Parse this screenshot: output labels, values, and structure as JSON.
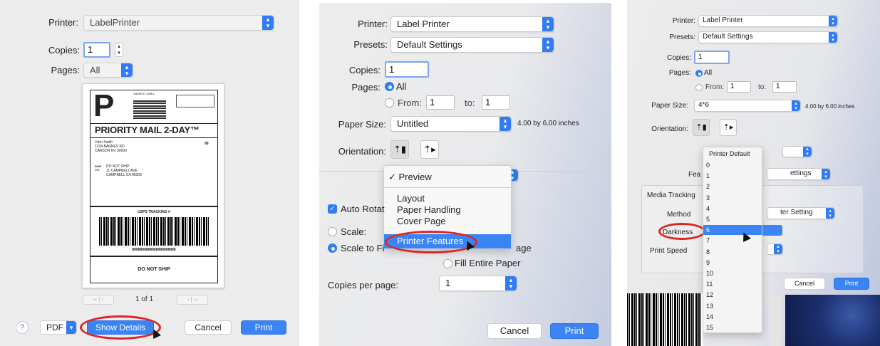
{
  "panel1": {
    "printer_label": "Printer:",
    "printer_value": "LabelPrinter",
    "copies_label": "Copies:",
    "copies_value": "1",
    "pages_label": "Pages:",
    "pages_value": "All",
    "preview": {
      "big_letter": "P",
      "small_header": "SAMPLE LABEL",
      "service": "PRIORITY MAIL 2-DAY™",
      "sender": [
        "John Smith",
        "1234 BARNES RD",
        "CARSON NV 30000"
      ],
      "zone": "99",
      "ship_label": "SHIP\nTO:",
      "ship_to": [
        "DO NOT SHIP",
        "11 CAMPBELL AVE",
        "CAMPBELL CA 95009"
      ],
      "tracking_label": "USPS TRACKING #",
      "tracking_number": "8888888888888888888888",
      "footer": "DO NOT SHIP"
    },
    "page_counter": "1 of 1",
    "help_label": "?",
    "pdf_label": "PDF",
    "show_details_label": "Show Details",
    "cancel_label": "Cancel",
    "print_label": "Print"
  },
  "panel2": {
    "printer_label": "Printer:",
    "printer_value": "Label Printer",
    "presets_label": "Presets:",
    "presets_value": "Default Settings",
    "copies_label": "Copies:",
    "copies_value": "1",
    "pages_label": "Pages:",
    "all_label": "All",
    "from_label": "From:",
    "from_value": "1",
    "to_label": "to:",
    "to_value": "1",
    "paper_size_label": "Paper Size:",
    "paper_size_value": "Untitled",
    "paper_size_desc": "4.00 by 6.00 inches",
    "orientation_label": "Orientation:",
    "menu": {
      "checked_item": "✓ Preview",
      "items": [
        "Layout",
        "Paper Handling",
        "Cover Page"
      ],
      "highlighted_item": "Printer Features"
    },
    "auto_rotate_label": "Auto Rotat",
    "scale_label": "Scale:",
    "scale_to_fit_label": "Scale to Fi",
    "age_fragment": "age",
    "fill_entire_paper_label": "Fill Entire Paper",
    "copies_per_page_label": "Copies per page:",
    "copies_per_page_value": "1",
    "cancel_label": "Cancel",
    "print_label": "Print"
  },
  "panel3": {
    "printer_label": "Printer:",
    "printer_value": "Label Printer",
    "presets_label": "Presets:",
    "presets_value": "Default Settings",
    "copies_label": "Copies:",
    "copies_value": "1",
    "pages_label": "Pages:",
    "all_label": "All",
    "from_label": "From:",
    "from_value": "1",
    "to_label": "to:",
    "to_value": "1",
    "paper_size_label": "Paper Size:",
    "paper_size_value": "4*6",
    "paper_size_desc": "4.00 by 6.00 inches",
    "orientation_label": "Orientation:",
    "features_label_fragment": "Fea",
    "feature_set_fragment": "ettings",
    "media_tracking_label": "Media Tracking",
    "method_label": "Method",
    "method_value_fragment": "ter Setting",
    "darkness_label": "Darkness",
    "print_speed_label": "Print Speed",
    "dropdown": {
      "header": "Printer Default",
      "items": [
        "0",
        "1",
        "2",
        "3",
        "4",
        "5",
        "6",
        "7",
        "8",
        "9",
        "10",
        "11",
        "12",
        "13",
        "14",
        "15"
      ],
      "selected": "6"
    },
    "cancel_label": "Cancel",
    "print_label": "Print"
  },
  "colors": {
    "accent": "#3b84f5",
    "highlight_ring": "#e02424"
  }
}
